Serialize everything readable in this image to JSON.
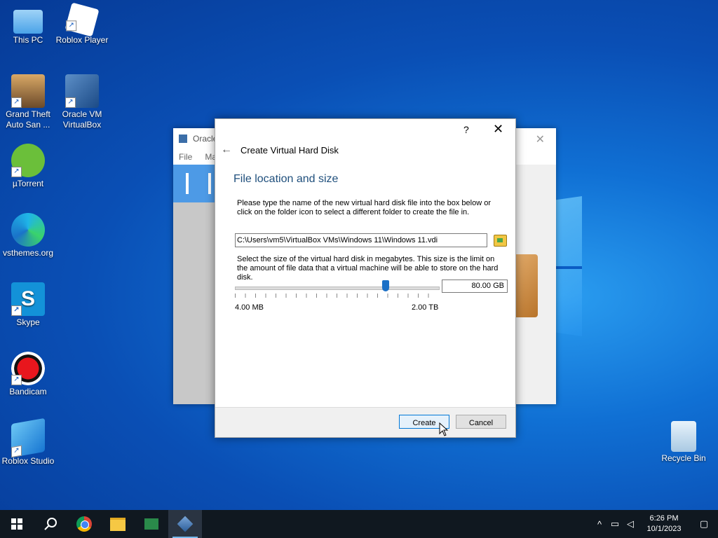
{
  "desktop": {
    "icons": [
      {
        "label": "This PC"
      },
      {
        "label": "Roblox Player"
      },
      {
        "label": "Grand Theft Auto San ..."
      },
      {
        "label": "Oracle VM VirtualBox"
      },
      {
        "label": "µTorrent"
      },
      {
        "label": "vsthemes.org"
      },
      {
        "label": "Skype"
      },
      {
        "label": "Bandicam"
      },
      {
        "label": "Roblox Studio"
      },
      {
        "label": "Recycle Bin"
      }
    ]
  },
  "vbox_manager": {
    "title": "Oracle",
    "menu": [
      "File",
      "Ma"
    ]
  },
  "dialog": {
    "help_glyph": "?",
    "close_glyph": "✕",
    "title": "Create Virtual Hard Disk",
    "section_title": "File location and size",
    "location_desc": "Please type the name of the new virtual hard disk file into the box below or click on the folder icon to select a different folder to create the file in.",
    "file_path": "C:\\Users\\vm5\\VirtualBox VMs\\Windows 11\\Windows 11.vdi",
    "size_desc": "Select the size of the virtual hard disk in megabytes. This size is the limit on the amount of file data that a virtual machine will be able to store on the hard disk.",
    "size_value": "80.00 GB",
    "slider_fraction": 0.74,
    "slider_min_label": "4.00 MB",
    "slider_max_label": "2.00 TB",
    "create_label": "Create",
    "cancel_label": "Cancel"
  },
  "taskbar": {
    "time": "6:26 PM",
    "date": "10/1/2023"
  },
  "colors": {
    "accent": "#0078d7",
    "section_title": "#1f4f7c",
    "taskbar": "#101820"
  }
}
